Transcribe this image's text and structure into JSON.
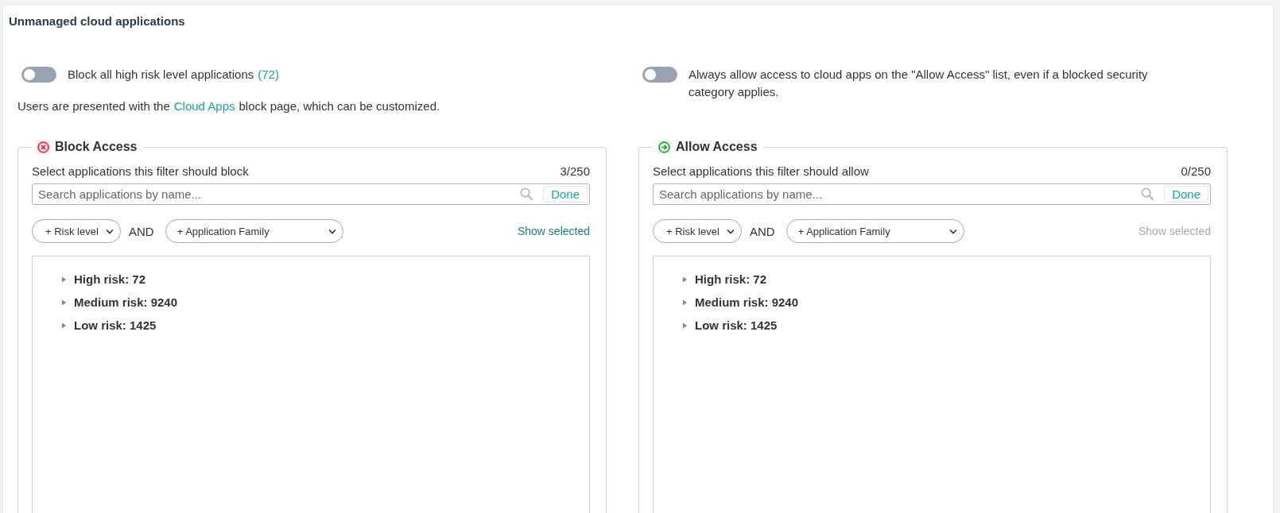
{
  "page": {
    "title": "Unmanaged cloud applications"
  },
  "toggles": [
    {
      "label": "Block all high risk level applications",
      "count": "(72)",
      "on": false
    },
    {
      "label": "Always allow access to cloud apps on the \"Allow Access\" list, even if a blocked security category applies.",
      "on": false
    }
  ],
  "note": {
    "before": "Users are presented with the",
    "link": "Cloud Apps",
    "after": "block page, which can be customized."
  },
  "panels": [
    {
      "kind": "block",
      "title": "Block Access",
      "instruction": "Select applications this filter should block",
      "count": "3/250",
      "search": {
        "placeholder": "Search applications by name..."
      },
      "done": "Done",
      "filters": [
        "+ Risk level",
        "+ Application Family"
      ],
      "conjunction": "AND",
      "show_selected": {
        "label": "Show selected",
        "disabled": false
      },
      "tree": [
        {
          "label": "High risk: 72",
          "expanded": false
        },
        {
          "label": "Medium risk: 9240",
          "expanded": false
        },
        {
          "label": "Low risk: 1425",
          "expanded": false
        }
      ]
    },
    {
      "kind": "allow",
      "title": "Allow Access",
      "instruction": "Select applications this filter should allow",
      "count": "0/250",
      "search": {
        "placeholder": "Search applications by name..."
      },
      "done": "Done",
      "filters": [
        "+ Risk level",
        "+ Application Family"
      ],
      "conjunction": "AND",
      "show_selected": {
        "label": "Show selected",
        "disabled": true
      },
      "tree": [
        {
          "label": "High risk: 72",
          "expanded": false
        },
        {
          "label": "Medium risk: 9240",
          "expanded": false
        },
        {
          "label": "Low risk: 1425",
          "expanded": false
        }
      ]
    }
  ]
}
